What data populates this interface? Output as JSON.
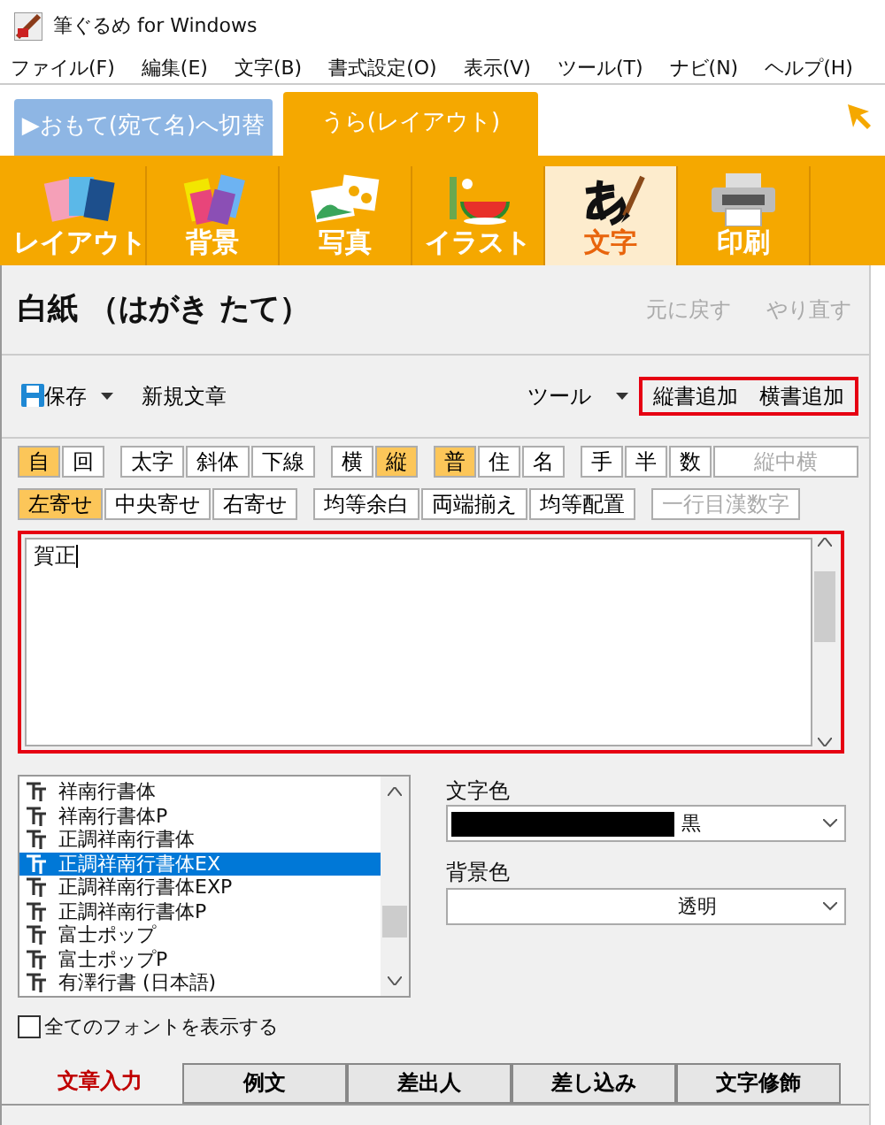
{
  "window": {
    "title": "筆ぐるめ for Windows"
  },
  "menu": [
    "ファイル(F)",
    "編集(E)",
    "文字(B)",
    "書式設定(O)",
    "表示(V)",
    "ツール(T)",
    "ナビ(N)",
    "ヘルプ(H)"
  ],
  "side_tabs": [
    {
      "label": "▶おもて(宛て名)へ切替",
      "selected": false
    },
    {
      "label": "うら(レイアウト)",
      "selected": true
    }
  ],
  "categories": [
    {
      "label": "レイアウト",
      "selected": false
    },
    {
      "label": "背景",
      "selected": false
    },
    {
      "label": "写真",
      "selected": false
    },
    {
      "label": "イラスト",
      "selected": false
    },
    {
      "label": "文字",
      "selected": true
    },
    {
      "label": "印刷",
      "selected": false
    }
  ],
  "document_title": "白紙 （はがき たて）",
  "history": [
    {
      "label": "元に戻す",
      "disabled": true
    },
    {
      "label": "やり直す",
      "disabled": true
    }
  ],
  "toolbar": {
    "save": "保存",
    "new": "新規文章",
    "tools": "ツール",
    "highlighted": [
      "縦書追加",
      "横書追加"
    ]
  },
  "format_rows": [
    [
      [
        {
          "label": "自",
          "selected": true
        },
        {
          "label": "回",
          "selected": false
        }
      ],
      [
        {
          "label": "太字",
          "selected": false
        },
        {
          "label": "斜体",
          "selected": false
        },
        {
          "label": "下線",
          "selected": false
        }
      ],
      [
        {
          "label": "横",
          "selected": false
        },
        {
          "label": "縦",
          "selected": true
        }
      ],
      [
        {
          "label": "普",
          "selected": true
        },
        {
          "label": "住",
          "selected": false
        },
        {
          "label": "名",
          "selected": false
        }
      ],
      [
        {
          "label": "手",
          "selected": false
        },
        {
          "label": "半",
          "selected": false
        },
        {
          "label": "数",
          "selected": false
        },
        {
          "label": "縦中横",
          "selected": false,
          "disabled": true
        }
      ]
    ],
    [
      [
        {
          "label": "左寄せ",
          "selected": true
        },
        {
          "label": "中央寄せ",
          "selected": false
        },
        {
          "label": "右寄せ",
          "selected": false
        }
      ],
      [
        {
          "label": "均等余白",
          "selected": false
        },
        {
          "label": "両端揃え",
          "selected": false
        },
        {
          "label": "均等配置",
          "selected": false
        }
      ],
      [
        {
          "label": "一行目漢数字",
          "selected": false,
          "disabled": true
        }
      ]
    ]
  ],
  "editor": {
    "text": "賀正"
  },
  "fonts": [
    {
      "name": "祥南行書体",
      "selected": false
    },
    {
      "name": "祥南行書体P",
      "selected": false
    },
    {
      "name": "正調祥南行書体",
      "selected": false
    },
    {
      "name": "正調祥南行書体EX",
      "selected": true
    },
    {
      "name": "正調祥南行書体EXP",
      "selected": false
    },
    {
      "name": "正調祥南行書体P",
      "selected": false
    },
    {
      "name": "富士ポップ",
      "selected": false
    },
    {
      "name": "富士ポップP",
      "selected": false
    },
    {
      "name": "有澤行書 (日本語)",
      "selected": false
    }
  ],
  "text_color": {
    "label": "文字色",
    "value": "黒",
    "color": "#000000"
  },
  "background_color": {
    "label": "背景色",
    "value": "透明"
  },
  "show_all_fonts": {
    "label": "全てのフォントを表示する",
    "checked": false
  },
  "bottom_tabs": [
    {
      "label": "文章入力",
      "selected": true
    },
    {
      "label": "例文",
      "selected": false
    },
    {
      "label": "差出人",
      "selected": false
    },
    {
      "label": "差し込み",
      "selected": false
    },
    {
      "label": "文字修飾",
      "selected": false
    }
  ]
}
